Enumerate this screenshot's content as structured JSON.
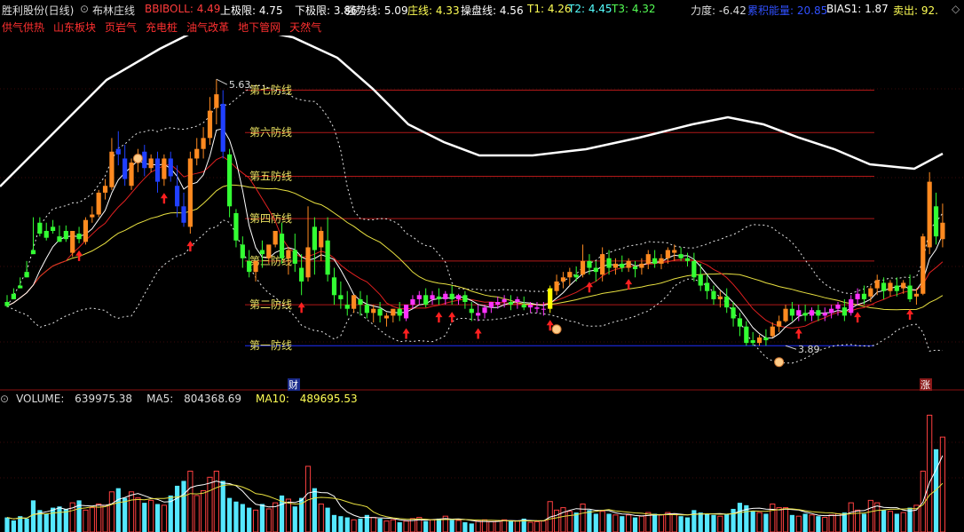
{
  "header": {
    "stock_name": "胜利股份(日线)",
    "indicator_name": "布林庄线",
    "items": [
      {
        "label": "BBIBOLL: ",
        "value": "4.49",
        "color": "#ff3b3b"
      },
      {
        "label": "上极限: ",
        "value": "4.75",
        "color": "#ffffff"
      },
      {
        "label": "下极限: ",
        "value": "3.86",
        "color": "#ffffff"
      },
      {
        "label": "强势线: ",
        "value": "5.09",
        "color": "#ffffff"
      },
      {
        "label": "庄线: ",
        "value": "4.33",
        "color": "#ffff55"
      },
      {
        "label": "操盘线: ",
        "value": "4.56",
        "color": "#ffffff"
      },
      {
        "label": "T1: ",
        "value": "4.26",
        "color": "#ffff55"
      },
      {
        "label": "T2: ",
        "value": "4.45",
        "color": "#55ffff"
      },
      {
        "label": "T3: ",
        "value": "4.32",
        "color": "#55ff55"
      },
      {
        "label": "力度: ",
        "value": "-6.42",
        "color": "#dddddd"
      },
      {
        "label": "累积能量: ",
        "value": "20.85",
        "color": "#3050ff"
      },
      {
        "label": "BIAS1: ",
        "value": "1.87",
        "color": "#ffffff"
      },
      {
        "label": "卖出: ",
        "value": "92.",
        "color": "#ffff55"
      }
    ]
  },
  "subtitle": {
    "concepts": [
      "供气供热",
      "山东板块",
      "页岩气",
      "充电桩",
      "油气改革",
      "地下管网",
      "天然气"
    ]
  },
  "defense_lines": [
    {
      "label": "第七防线",
      "value": 5.55,
      "color": "#b01818"
    },
    {
      "label": "第六防线",
      "value": 5.24,
      "color": "#b01818"
    },
    {
      "label": "第五防线",
      "value": 4.92,
      "color": "#b01818"
    },
    {
      "label": "第四防线",
      "value": 4.61,
      "color": "#b01818"
    },
    {
      "label": "第三防线",
      "value": 4.3,
      "color": "#b01818"
    },
    {
      "label": "第二防线",
      "value": 3.98,
      "color": "#b01818"
    },
    {
      "label": "第一防线",
      "value": 3.68,
      "color": "#2030ff"
    }
  ],
  "annotations": {
    "high_label": "5.63",
    "low_label": "3.89",
    "caiwu_tag": "财",
    "zhang_tag": "涨"
  },
  "volume_header": {
    "volume": {
      "label": "VOLUME: ",
      "value": "639975.38",
      "color": "#dddddd"
    },
    "ma5": {
      "label": "MA5: ",
      "value": "804368.69",
      "color": "#dddddd"
    },
    "ma10": {
      "label": "MA10: ",
      "value": "489695.53",
      "color": "#ffff55"
    }
  },
  "chart_data": {
    "type": "candlestick",
    "title": "",
    "ylim": [
      3.35,
      5.95
    ],
    "volume_ylim": [
      0,
      1000000
    ],
    "candles": [
      [
        4.0,
        4.05,
        3.97,
        3.96
      ],
      [
        4.06,
        4.1,
        4.02,
        4.02
      ],
      [
        4.12,
        4.18,
        4.1,
        4.1
      ],
      [
        4.22,
        4.3,
        4.18,
        4.18
      ],
      [
        4.38,
        4.62,
        4.35,
        4.35
      ],
      [
        4.58,
        4.62,
        4.5,
        4.48
      ],
      [
        4.52,
        4.58,
        4.47,
        4.45
      ],
      [
        4.55,
        4.6,
        4.52,
        4.5
      ],
      [
        4.48,
        4.56,
        4.44,
        4.44
      ],
      [
        4.52,
        4.56,
        4.46,
        4.44
      ],
      [
        4.36,
        4.52,
        4.52,
        4.33
      ],
      [
        4.5,
        4.55,
        4.46,
        4.43
      ],
      [
        4.44,
        4.62,
        4.6,
        4.42
      ],
      [
        4.62,
        4.7,
        4.64,
        4.58
      ],
      [
        4.64,
        4.82,
        4.8,
        4.62
      ],
      [
        4.8,
        4.9,
        4.85,
        4.75
      ],
      [
        4.84,
        5.2,
        5.1,
        4.82
      ],
      [
        5.12,
        5.25,
        5.08,
        5.0
      ],
      [
        5.05,
        5.15,
        4.9,
        4.85
      ],
      [
        4.85,
        5.05,
        5.02,
        4.82
      ],
      [
        5.03,
        5.12,
        5.08,
        4.95
      ],
      [
        5.1,
        5.15,
        4.98,
        4.92
      ],
      [
        4.98,
        5.08,
        5.05,
        4.95
      ],
      [
        5.05,
        5.1,
        4.88,
        4.8
      ],
      [
        4.9,
        5.08,
        5.05,
        4.85
      ],
      [
        5.05,
        5.1,
        4.92,
        4.88
      ],
      [
        4.85,
        5.0,
        4.7,
        4.62
      ],
      [
        4.7,
        4.8,
        4.58,
        4.55
      ],
      [
        4.55,
        5.1,
        5.05,
        4.5
      ],
      [
        5.05,
        5.2,
        5.12,
        5.0
      ],
      [
        5.12,
        5.28,
        5.2,
        5.05
      ],
      [
        5.2,
        5.5,
        5.4,
        5.15
      ],
      [
        5.42,
        5.63,
        5.52,
        5.3
      ],
      [
        5.45,
        5.55,
        5.1,
        5.05
      ],
      [
        5.08,
        5.12,
        4.7,
        4.62
      ],
      [
        4.65,
        4.68,
        4.45,
        4.4
      ],
      [
        4.42,
        4.48,
        4.32,
        4.25
      ],
      [
        4.3,
        4.38,
        4.22,
        4.18
      ],
      [
        4.22,
        4.28,
        4.3,
        4.15
      ],
      [
        4.38,
        4.45,
        4.35,
        4.25
      ],
      [
        4.32,
        4.4,
        4.42,
        4.28
      ],
      [
        4.42,
        4.5,
        4.52,
        4.4
      ],
      [
        4.5,
        4.58,
        4.32,
        4.28
      ],
      [
        4.32,
        4.4,
        4.38,
        4.2
      ],
      [
        4.38,
        4.5,
        4.28,
        4.22
      ],
      [
        4.25,
        4.35,
        4.15,
        4.05
      ],
      [
        4.18,
        4.7,
        4.4,
        4.15
      ],
      [
        4.55,
        4.62,
        4.38,
        4.2
      ],
      [
        4.4,
        4.55,
        4.52,
        4.3
      ],
      [
        4.45,
        4.62,
        4.2,
        4.15
      ],
      [
        4.18,
        4.25,
        4.05,
        3.98
      ],
      [
        4.05,
        4.15,
        4.02,
        3.95
      ],
      [
        3.98,
        4.08,
        3.95,
        3.9
      ],
      [
        3.95,
        4.02,
        4.05,
        3.92
      ],
      [
        4.02,
        4.08,
        3.98,
        3.9
      ],
      [
        3.98,
        4.05,
        3.92,
        3.88
      ],
      [
        3.92,
        3.98,
        3.95,
        3.85
      ],
      [
        3.95,
        4.0,
        3.9,
        3.85
      ],
      [
        3.88,
        3.92,
        3.9,
        3.82
      ],
      [
        3.9,
        3.95,
        3.95,
        3.85
      ],
      [
        3.95,
        4.0,
        3.9,
        3.86
      ],
      [
        3.88,
        3.92,
        3.98,
        3.86
      ],
      [
        3.98,
        4.05,
        4.02,
        3.95
      ],
      [
        4.02,
        4.08,
        4.05,
        3.98
      ],
      [
        4.05,
        4.1,
        3.98,
        3.96
      ],
      [
        4.02,
        4.08,
        4.05,
        3.98
      ],
      [
        4.04,
        4.1,
        4.02,
        3.98
      ],
      [
        4.02,
        4.08,
        4.06,
        3.98
      ],
      [
        4.06,
        4.12,
        4.02,
        3.98
      ],
      [
        4.02,
        4.06,
        4.05,
        3.98
      ],
      [
        4.05,
        4.08,
        4.0,
        3.95
      ],
      [
        3.95,
        4.0,
        3.92,
        3.86
      ],
      [
        3.9,
        3.98,
        3.92,
        3.86
      ],
      [
        3.92,
        3.98,
        3.96,
        3.88
      ],
      [
        3.96,
        4.0,
        4.0,
        3.92
      ],
      [
        3.98,
        4.04,
        4.0,
        3.95
      ],
      [
        4.0,
        4.05,
        4.02,
        3.96
      ],
      [
        4.0,
        4.05,
        3.98,
        3.94
      ],
      [
        4.0,
        4.04,
        4.02,
        3.95
      ],
      [
        3.98,
        4.04,
        3.96,
        3.94
      ],
      [
        3.96,
        4.0,
        3.98,
        3.92
      ],
      [
        3.95,
        4.0,
        3.96,
        3.92
      ],
      [
        3.95,
        4.0,
        3.95,
        3.9
      ],
      [
        3.95,
        4.12,
        4.1,
        3.92
      ],
      [
        4.08,
        4.2,
        4.15,
        4.05
      ],
      [
        4.15,
        4.22,
        4.18,
        4.1
      ],
      [
        4.18,
        4.25,
        4.22,
        4.12
      ],
      [
        4.2,
        4.26,
        4.18,
        4.15
      ],
      [
        4.2,
        4.42,
        4.3,
        4.18
      ],
      [
        4.3,
        4.35,
        4.25,
        4.2
      ],
      [
        4.25,
        4.3,
        4.22,
        4.15
      ],
      [
        4.2,
        4.4,
        4.35,
        4.15
      ],
      [
        4.32,
        4.38,
        4.25,
        4.2
      ],
      [
        4.25,
        4.32,
        4.28,
        4.2
      ],
      [
        4.28,
        4.34,
        4.25,
        4.22
      ],
      [
        4.25,
        4.32,
        4.3,
        4.22
      ],
      [
        4.26,
        4.3,
        4.24,
        4.18
      ],
      [
        4.25,
        4.32,
        4.28,
        4.2
      ],
      [
        4.28,
        4.38,
        4.35,
        4.24
      ],
      [
        4.32,
        4.38,
        4.28,
        4.25
      ],
      [
        4.28,
        4.35,
        4.32,
        4.24
      ],
      [
        4.32,
        4.4,
        4.38,
        4.28
      ],
      [
        4.36,
        4.42,
        4.38,
        4.3
      ],
      [
        4.35,
        4.4,
        4.32,
        4.3
      ],
      [
        4.32,
        4.36,
        4.3,
        4.26
      ],
      [
        4.3,
        4.36,
        4.18,
        4.15
      ],
      [
        4.2,
        4.28,
        4.12,
        4.08
      ],
      [
        4.14,
        4.2,
        4.08,
        4.02
      ],
      [
        4.08,
        4.12,
        4.02,
        3.98
      ],
      [
        4.02,
        4.08,
        4.04,
        3.96
      ],
      [
        4.04,
        4.1,
        3.96,
        3.92
      ],
      [
        3.96,
        4.0,
        3.88,
        3.82
      ],
      [
        3.88,
        3.92,
        3.82,
        3.75
      ],
      [
        3.82,
        3.86,
        3.7,
        3.68
      ],
      [
        3.72,
        3.78,
        3.7,
        3.68
      ],
      [
        3.7,
        3.76,
        3.74,
        3.68
      ],
      [
        3.74,
        3.8,
        3.72,
        3.68
      ],
      [
        3.75,
        3.85,
        3.82,
        3.74
      ],
      [
        3.82,
        3.9,
        3.86,
        3.78
      ],
      [
        3.86,
        3.98,
        3.95,
        3.85
      ],
      [
        3.95,
        4.0,
        3.9,
        3.86
      ],
      [
        3.9,
        3.98,
        3.94,
        3.86
      ],
      [
        3.92,
        3.98,
        3.9,
        3.86
      ],
      [
        3.9,
        3.96,
        3.94,
        3.86
      ],
      [
        3.94,
        3.98,
        3.9,
        3.86
      ],
      [
        3.9,
        3.96,
        3.92,
        3.86
      ],
      [
        3.92,
        3.98,
        3.95,
        3.88
      ],
      [
        3.95,
        4.0,
        3.98,
        3.9
      ],
      [
        3.96,
        4.02,
        3.9,
        3.86
      ],
      [
        3.92,
        4.05,
        4.02,
        3.9
      ],
      [
        4.02,
        4.1,
        4.06,
        3.98
      ],
      [
        4.06,
        4.12,
        4.02,
        3.98
      ],
      [
        4.04,
        4.12,
        4.1,
        4.0
      ],
      [
        4.1,
        4.2,
        4.16,
        4.05
      ],
      [
        4.14,
        4.18,
        4.08,
        4.02
      ],
      [
        4.08,
        4.16,
        4.14,
        4.04
      ],
      [
        4.12,
        4.18,
        4.08,
        4.04
      ],
      [
        4.1,
        4.16,
        4.14,
        4.06
      ],
      [
        4.12,
        4.2,
        4.02,
        4.0
      ],
      [
        4.04,
        4.1,
        4.06,
        3.98
      ],
      [
        4.06,
        4.5,
        4.48,
        4.05
      ],
      [
        4.4,
        4.95,
        4.88,
        4.35
      ],
      [
        4.7,
        4.8,
        4.48,
        4.42
      ],
      [
        4.46,
        4.72,
        4.58,
        4.4
      ]
    ],
    "volumes": [
      120,
      95,
      130,
      110,
      260,
      180,
      150,
      200,
      210,
      190,
      240,
      260,
      180,
      200,
      230,
      220,
      330,
      360,
      280,
      330,
      280,
      240,
      260,
      230,
      220,
      300,
      380,
      420,
      500,
      300,
      340,
      450,
      500,
      420,
      280,
      250,
      230,
      200,
      180,
      230,
      190,
      240,
      300,
      270,
      210,
      280,
      540,
      360,
      230,
      200,
      140,
      130,
      120,
      100,
      110,
      140,
      120,
      110,
      90,
      100,
      80,
      90,
      110,
      120,
      90,
      100,
      110,
      130,
      100,
      95,
      80,
      70,
      90,
      100,
      85,
      90,
      100,
      95,
      90,
      110,
      80,
      85,
      90,
      250,
      180,
      200,
      170,
      160,
      230,
      180,
      150,
      170,
      150,
      140,
      130,
      140,
      120,
      130,
      160,
      150,
      140,
      160,
      150,
      130,
      120,
      180,
      160,
      150,
      140,
      130,
      150,
      190,
      240,
      220,
      170,
      160,
      150,
      230,
      200,
      200,
      140,
      130,
      150,
      140,
      130,
      120,
      140,
      150,
      160,
      240,
      180,
      150,
      260,
      240,
      180,
      170,
      150,
      160,
      200,
      220,
      500,
      960,
      680,
      780
    ]
  }
}
